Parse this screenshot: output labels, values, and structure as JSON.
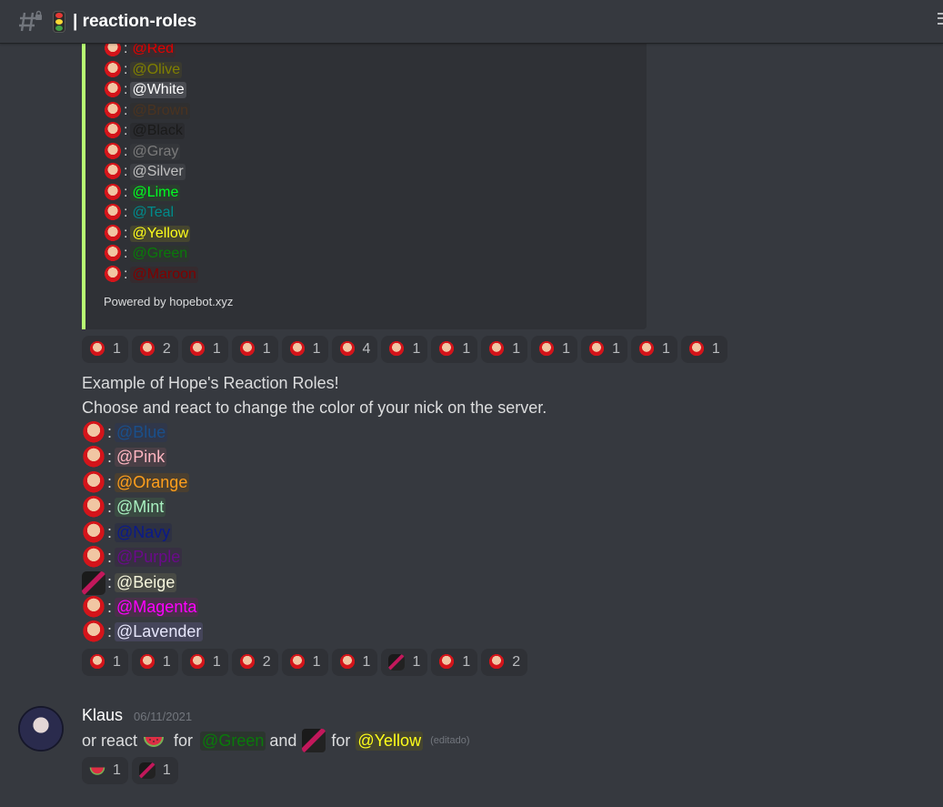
{
  "header": {
    "channel_name": "| reaction-roles"
  },
  "embed": {
    "border_color": "#b8ff73",
    "roles": [
      {
        "label": "@Red",
        "color": "#e50000",
        "bg": "#3a2b2f"
      },
      {
        "label": "@Olive",
        "color": "#808000",
        "bg": "#3a3a2f"
      },
      {
        "label": "@White",
        "color": "#ffffff",
        "bg": "#4a4c52"
      },
      {
        "label": "@Brown",
        "color": "#4a3320",
        "bg": "#2f2f30"
      },
      {
        "label": "@Black",
        "color": "#1a1a1a",
        "bg": "#2a2b2f"
      },
      {
        "label": "@Gray",
        "color": "#7a7a7a",
        "bg": "#34363a"
      },
      {
        "label": "@Silver",
        "color": "#c0c0c0",
        "bg": "#3c3e43"
      },
      {
        "label": "@Lime",
        "color": "#00ff22",
        "bg": "#2b3d2f"
      },
      {
        "label": "@Teal",
        "color": "#008b8b",
        "bg": "#2b3536"
      },
      {
        "label": "@Yellow",
        "color": "#ffff1a",
        "bg": "#45452f"
      },
      {
        "label": "@Green",
        "color": "#0a7a0a",
        "bg": "#2c352f"
      },
      {
        "label": "@Maroon",
        "color": "#800000",
        "bg": "#352b2f"
      }
    ],
    "footer": "Powered by hopebot.xyz"
  },
  "reactions_1": [
    "1",
    "2",
    "1",
    "1",
    "1",
    "4",
    "1",
    "1",
    "1",
    "1",
    "1",
    "1",
    "1"
  ],
  "message": {
    "line1": "Example of Hope's Reaction Roles!",
    "line2": "Choose and react to change the color of your nick on the server.",
    "roles": [
      {
        "label": "@Blue",
        "color": "#1a4f8a",
        "bg": "#30374a"
      },
      {
        "label": "@Pink",
        "color": "#ffb6c1",
        "bg": "#4a3f46"
      },
      {
        "label": "@Orange",
        "color": "#ff9f1c",
        "bg": "#4a3f30"
      },
      {
        "label": "@Mint",
        "color": "#a8f0c0",
        "bg": "#3a4a42"
      },
      {
        "label": "@Navy",
        "color": "#0a1a8a",
        "bg": "#2e3142"
      },
      {
        "label": "@Purple",
        "color": "#6a0a8a",
        "bg": "#372f42"
      },
      {
        "label": "@Beige",
        "color": "#f5f5dc",
        "bg": "#484a45"
      },
      {
        "label": "@Magenta",
        "color": "#ff00ff",
        "bg": "#4a2f4a"
      },
      {
        "label": "@Lavender",
        "color": "#e6e6fa",
        "bg": "#45455a"
      }
    ]
  },
  "reactions_2": [
    "1",
    "1",
    "1",
    "2",
    "1",
    "1",
    "1",
    "1",
    "2"
  ],
  "klaus": {
    "author": "Klaus",
    "timestamp": "06/11/2021",
    "text_before": "or react",
    "for1": "for",
    "mention_green": "@Green",
    "and": "and",
    "for2": "for",
    "mention_yellow": "@Yellow",
    "edited": "(editado)"
  },
  "reactions_3": [
    "1",
    "1"
  ]
}
